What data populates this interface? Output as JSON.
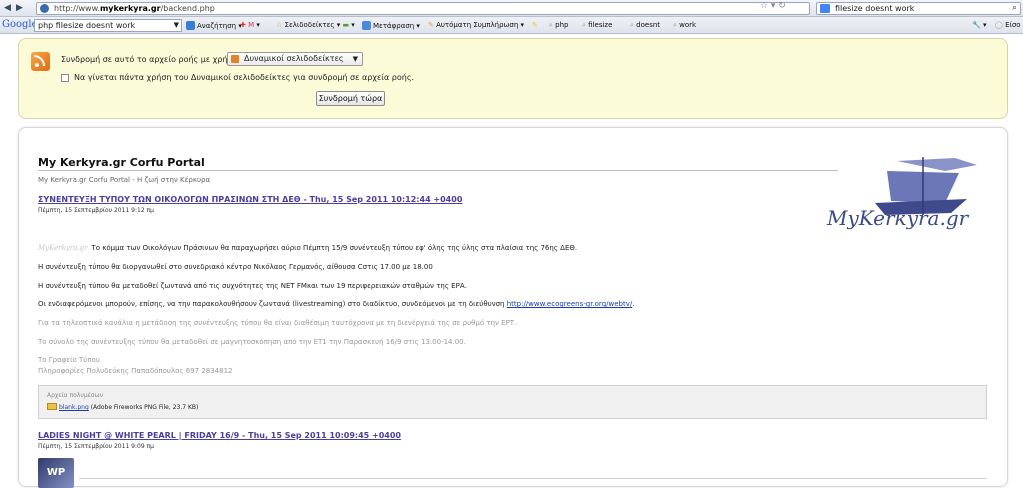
{
  "browser": {
    "back_icon": "back-arrow-icon",
    "forward_icon": "forward-arrow-icon",
    "url_prefix": "http://www.",
    "url_domain": "mykerkyra.gr",
    "url_path": "/backend.php",
    "search_value": "filesize doesnt work"
  },
  "google_toolbar": {
    "logo": "Google",
    "query": "php filesize doesnt work",
    "items": [
      "Αναζήτηση",
      "Σελιδοδείκτες",
      "Μετάφραση",
      "Αυτόματη Συμπλήρωση",
      "php",
      "filesize",
      "doesnt",
      "work",
      "Είσο"
    ]
  },
  "feed_subscribe": {
    "label": "Συνδρομή σε αυτό το αρχείο ροής με χρήση",
    "selected_reader": "Δυναμικοί σελιδοδείκτες",
    "checkbox_label": "Να γίνεται πάντα χρήση του Δυναμικοί σελιδοδείκτες για συνδρομή σε αρχεία ροής.",
    "checkbox_checked": false,
    "subscribe_button": "Συνδρομή τώρα"
  },
  "feed": {
    "title": "My Kerkyra.gr Corfu Portal",
    "subtitle": "My Kerkyra.gr Corfu Portal - Η ζωή στην Κέρκυρα",
    "logo_text": "MyKerkyra.gr",
    "entries": [
      {
        "title": "ΣΥΝΕΝΤΕΥΞΗ ΤΥΠΟΥ ΤΩΝ ΟΙΚΟΛΟΓΩΝ ΠΡΑΣΙΝΩΝ ΣΤΗ ΔΕΘ - Thu, 15 Sep 2011 10:12:44 +0400",
        "date": "Πέμπτη, 15 Σεπτεμβρίου 2011 9:12 πμ",
        "watermark": "MyKerkyra.gr",
        "paragraphs": [
          "Το κόμμα των Οικολόγων Πράσινων θα παραχωρήσει αύριο Πέμπτη 15/9 συνέντευξη τύπου εφ' όλης της ύλης στα πλαίσια της 76ης ΔΕΘ.",
          "Η συνέντευξη τύπου θα διοργανωθεί στο συνεδριακό κέντρο Νικόλαος Γερμανός, αίθουσα Cστις 17.00 με 18.00",
          "Η συνέντευξη τύπου θα μεταδοθεί ζωντανά από τις συχνότητες της ΝΕΤ FMκαι των 19 περιφερειακών σταθμών της ΕΡΑ.",
          "Οι ενδιαφερόμενοι μπορούν, επίσης, να την παρακολουθήσουν ζωντανά (livestreaming) στο διαδίκτυο, συνδεόμενοι με τη διεύθυνση",
          "Για τα τηλεοπτικά κανάλια η μετάδοση της συνέντευξης τύπου θα είναι διαθέσιμη ταυτόχρονα με τη διενέργειά της σε ρυθμό την ΕΡΤ.",
          "Το σύνολο της συνέντευξης τύπου θα μεταδοθεί σε μαγνητοσκόπηση από την ΕΤ1 την Παρασκευή 16/9 στις 13.00-14.00.",
          "Το Γραφείο Τύπου",
          "Πληροφορίες Πολυδεύκης Παπαδόπουλος 697 2834812"
        ],
        "link": "http://www.ecogreens-gr.org/webtv/",
        "enclosure_label": "Αρχεία πολυμέσων",
        "enclosure_file": "blank.png",
        "enclosure_meta": "(Adobe Fireworks PNG File, 23.7 KB)"
      },
      {
        "title": "LADIES NIGHT @ WHITE PEARL | FRIDAY 16/9 - Thu, 15 Sep 2011 10:09:45 +0400",
        "date": "Πέμπτη, 15 Σεπτεμβρίου 2011 9:09 πμ",
        "thumb_text": "WP"
      }
    ]
  }
}
